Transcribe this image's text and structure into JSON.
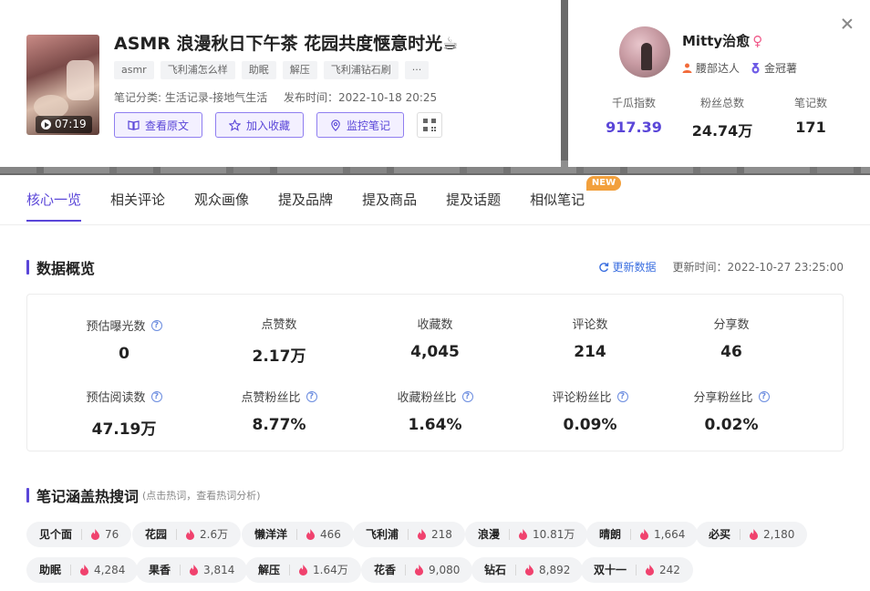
{
  "note": {
    "title": "ASMR 浪漫秋日下午茶 花园共度惬意时光☕",
    "duration": "07:19",
    "tags": [
      "asmr",
      "飞利浦怎么样",
      "助眠",
      "解压",
      "飞利浦钻石刷",
      "···"
    ],
    "category": "笔记分类: 生活记录-接地气生活",
    "publish_time": "发布时间：2022-10-18 20:25",
    "actions": {
      "view": "查看原文",
      "collect": "加入收藏",
      "monitor": "监控笔记"
    }
  },
  "author": {
    "name": "Mitty治愈",
    "gender_symbol": "♀",
    "badge1": "腰部达人",
    "badge2": "金冠薯",
    "stats": [
      {
        "label": "千瓜指数",
        "value": "917.39"
      },
      {
        "label": "粉丝总数",
        "value": "24.74万"
      },
      {
        "label": "笔记数",
        "value": "171"
      }
    ]
  },
  "tabs": [
    {
      "label": "核心一览"
    },
    {
      "label": "相关评论"
    },
    {
      "label": "观众画像"
    },
    {
      "label": "提及品牌"
    },
    {
      "label": "提及商品"
    },
    {
      "label": "提及话题"
    },
    {
      "label": "相似笔记"
    }
  ],
  "new_badge": "NEW",
  "overview": {
    "title": "数据概览",
    "refresh": "更新数据",
    "update_time": "更新时间：2022-10-27 23:25:00",
    "row1": [
      {
        "label": "预估曝光数",
        "value": "0"
      },
      {
        "label": "点赞数",
        "value": "2.17万"
      },
      {
        "label": "收藏数",
        "value": "4,045"
      },
      {
        "label": "评论数",
        "value": "214"
      },
      {
        "label": "分享数",
        "value": "46"
      }
    ],
    "row2": [
      {
        "label": "预估阅读数",
        "value": "47.19万"
      },
      {
        "label": "点赞粉丝比",
        "value": "8.77%"
      },
      {
        "label": "收藏粉丝比",
        "value": "1.64%"
      },
      {
        "label": "评论粉丝比",
        "value": "0.09%"
      },
      {
        "label": "分享粉丝比",
        "value": "0.02%"
      }
    ]
  },
  "hot_words": {
    "title": "笔记涵盖热搜词",
    "hint": "(点击热词，查看热词分析)",
    "row1": [
      {
        "word": "见个面",
        "count": "76"
      },
      {
        "word": "花园",
        "count": "2.6万"
      },
      {
        "word": "懒洋洋",
        "count": "466"
      },
      {
        "word": "飞利浦",
        "count": "218"
      },
      {
        "word": "浪漫",
        "count": "10.81万"
      },
      {
        "word": "晴朗",
        "count": "1,664"
      },
      {
        "word": "必买",
        "count": "2,180"
      }
    ],
    "row2": [
      {
        "word": "助眠",
        "count": "4,284"
      },
      {
        "word": "果香",
        "count": "3,814"
      },
      {
        "word": "解压",
        "count": "1.64万"
      },
      {
        "word": "花香",
        "count": "9,080"
      },
      {
        "word": "钻石",
        "count": "8,892"
      },
      {
        "word": "双十一",
        "count": "242"
      }
    ]
  },
  "colors": {
    "accent": "#5a46d8",
    "link": "#3b6fe0",
    "flame": "#f0426e",
    "new": "#f2a03c"
  }
}
